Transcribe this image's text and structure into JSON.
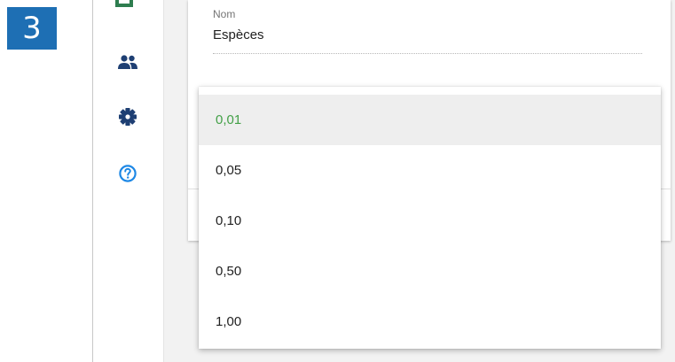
{
  "step": {
    "number": "3"
  },
  "form": {
    "name_label": "Nom",
    "name_value": "Espèces"
  },
  "dropdown": {
    "options": [
      {
        "label": "0,01",
        "selected": true
      },
      {
        "label": "0,05"
      },
      {
        "label": "0,10"
      },
      {
        "label": "0,50"
      },
      {
        "label": "1,00"
      }
    ]
  },
  "icons": {
    "people": "people-icon",
    "settings": "gear-icon",
    "help": "help-icon"
  },
  "colors": {
    "badge": "#1e6fb4",
    "sidebar_icon": "#1e3f73",
    "help_icon": "#1e88e5",
    "selected_text": "#43a047",
    "selected_bg": "#eeeeee"
  }
}
